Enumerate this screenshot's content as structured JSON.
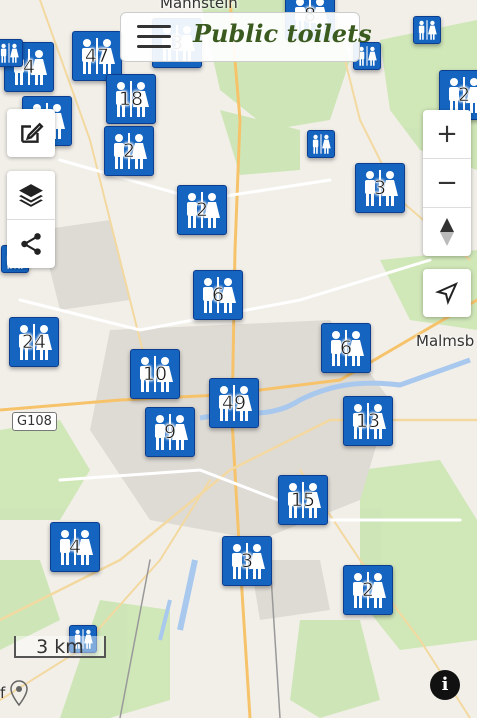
{
  "app": {
    "title": "Public toilets"
  },
  "map": {
    "places": [
      "Mannstein",
      "Malmsb"
    ],
    "road_shield": "G108",
    "scale_label": "3 km",
    "bottom_left_text": "f",
    "markers": [
      {
        "count": "47"
      },
      {
        "count": "4"
      },
      {
        "count": "18"
      },
      {
        "count": "2"
      },
      {
        "count": "2"
      },
      {
        "count": "2"
      },
      {
        "count": "3"
      },
      {
        "count": "6"
      },
      {
        "count": "24"
      },
      {
        "count": "10"
      },
      {
        "count": "6"
      },
      {
        "count": "49"
      },
      {
        "count": "9"
      },
      {
        "count": "13"
      },
      {
        "count": "15"
      },
      {
        "count": "4"
      },
      {
        "count": "3"
      },
      {
        "count": "2"
      },
      {
        "count": "2"
      },
      {
        "count": "8"
      },
      {
        "count": "3"
      },
      {
        "count": ""
      },
      {
        "count": ""
      },
      {
        "count": ""
      },
      {
        "count": ""
      },
      {
        "count": ""
      },
      {
        "count": ""
      }
    ]
  },
  "controls": {
    "zoom_in": "+",
    "zoom_out": "−",
    "reset_north_icon": "compass-icon",
    "locate_icon": "locate-arrow-icon",
    "edit_icon": "edit-icon",
    "layers_icon": "layers-icon",
    "share_icon": "share-icon",
    "info_label": "i"
  },
  "colors": {
    "marker": "#1565c0",
    "title": "#3a5a1f"
  }
}
